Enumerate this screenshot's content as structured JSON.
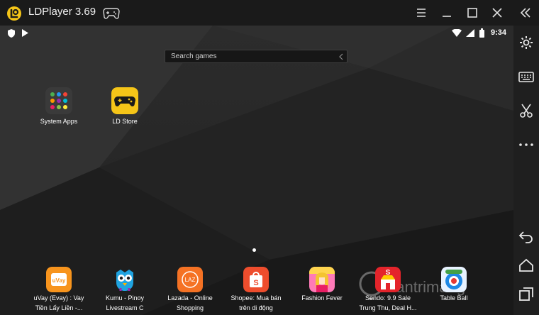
{
  "window": {
    "title": "LDPlayer 3.69",
    "colors": {
      "accent": "#f5c518",
      "titlebar": "#1a1a1a",
      "toolbar": "#1f1f1f"
    }
  },
  "statusbar": {
    "time": "9:34"
  },
  "search": {
    "placeholder": "Search games"
  },
  "desktop": {
    "apps": [
      {
        "label": "System Apps",
        "icon": "folder-grid-icon"
      },
      {
        "label": "LD Store",
        "icon": "ld-store-icon"
      }
    ]
  },
  "dock": {
    "apps": [
      {
        "label_line1": "uVay (Evay) : Vay",
        "label_line2": "Tiền Lấy Liền -...",
        "icon_text": "uVay"
      },
      {
        "label_line1": "Kumu - Pinoy",
        "label_line2": "Livestream C",
        "icon_text": ""
      },
      {
        "label_line1": "Lazada - Online",
        "label_line2": "Shopping",
        "icon_text": "LAZ"
      },
      {
        "label_line1": "Shopee: Mua bán",
        "label_line2": "trên di động",
        "icon_text": "S"
      },
      {
        "label_line1": "Fashion Fever",
        "label_line2": "",
        "icon_text": ""
      },
      {
        "label_line1": "Sendo: 9.9 Sale",
        "label_line2": "Trung Thu, Deal H...",
        "icon_text": "S"
      },
      {
        "label_line1": "Table Ball",
        "label_line2": "",
        "icon_text": ""
      }
    ]
  },
  "watermark": {
    "text": "uantrimang"
  }
}
